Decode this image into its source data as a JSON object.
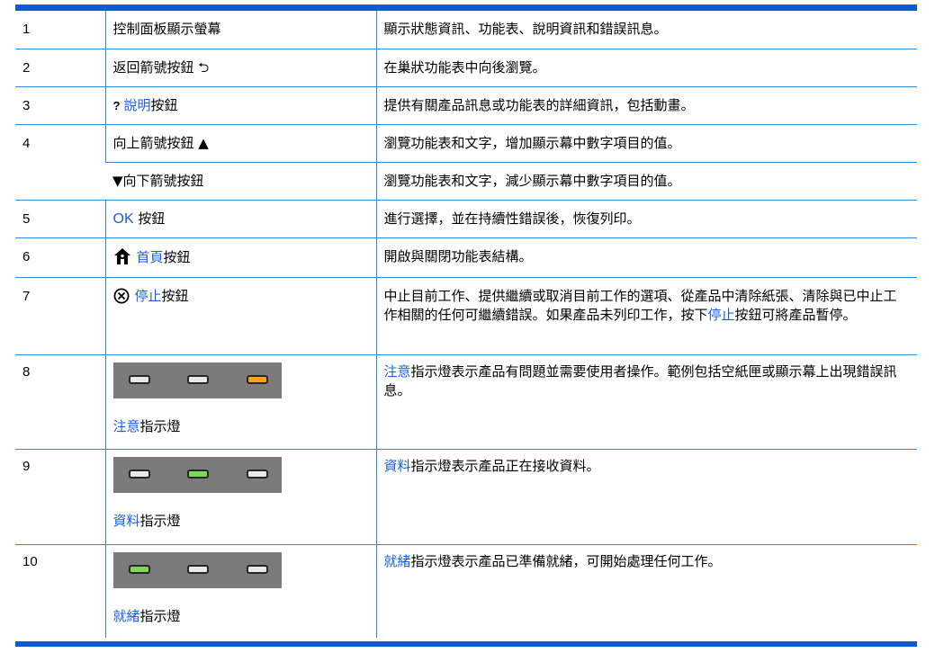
{
  "rows": [
    {
      "num": "1",
      "name": "控制面板顯示螢幕",
      "desc": "顯示狀態資訊、功能表、說明資訊和錯誤訊息。"
    },
    {
      "num": "2",
      "name": "返回箭號按鈕",
      "name_glyph": "⮌",
      "desc": "在巢狀功能表中向後瀏覽。"
    },
    {
      "num": "3",
      "qmark": "?",
      "name_blue": "說明",
      "name_rest": "按鈕",
      "desc": "提供有關產品訊息或功能表的詳細資訊，包括動畫。"
    },
    {
      "num": "4",
      "name": "向上箭號按鈕 ▲",
      "desc": "瀏覽功能表和文字，增加顯示幕中數字項目的值。"
    },
    {
      "name": "▼向下箭號按鈕",
      "desc": "瀏覽功能表和文字，減少顯示幕中數字項目的值。"
    },
    {
      "num": "5",
      "name_blue": "OK",
      "name_rest": " 按鈕",
      "desc": "進行選擇，並在持續性錯誤後，恢復列印。"
    },
    {
      "num": "6",
      "name_blue": "首頁",
      "name_rest": "按鈕",
      "desc": "開啟與關閉功能表結構。"
    },
    {
      "num": "7",
      "name_blue": "停止",
      "name_rest": "按鈕",
      "desc_pre": "中止目前工作、提供繼續或取消目前工作的選項、從產品中清除紙張、清除與已中止工作相關的任何可繼續錯誤。如果產品未列印工作，按下",
      "desc_blue": "停止",
      "desc_post": "按鈕可將產品暫停。"
    },
    {
      "num": "8",
      "name_blue": "注意",
      "name_rest": "指示燈",
      "desc_blue": "注意",
      "desc_rest": "指示燈表示產品有問題並需要使用者操作。範例包括空紙匣或顯示幕上出現錯誤訊息。",
      "leds": [
        "off",
        "off",
        "amber"
      ]
    },
    {
      "num": "9",
      "name_blue": "資料",
      "name_rest": "指示燈",
      "desc_blue": "資料",
      "desc_rest": "指示燈表示產品正在接收資料。",
      "leds": [
        "off",
        "green",
        "off"
      ]
    },
    {
      "num": "10",
      "name_blue": "就緒",
      "name_rest": "指示燈",
      "desc_blue": "就緒",
      "desc_rest": "指示燈表示產品已準備就緒，可開始處理任何工作。",
      "leds": [
        "green",
        "off",
        "off"
      ]
    }
  ],
  "colors": {
    "accent": "#0b5bd3",
    "link": "#1a5fe0",
    "rule": "#2e8bd8",
    "led_panel": "#7b7b7b",
    "led_amber": "#ffa01a",
    "led_green": "#7ed957"
  },
  "icons": {
    "back": "back-arrow-icon",
    "home": "home-icon",
    "stop": "stop-icon"
  }
}
